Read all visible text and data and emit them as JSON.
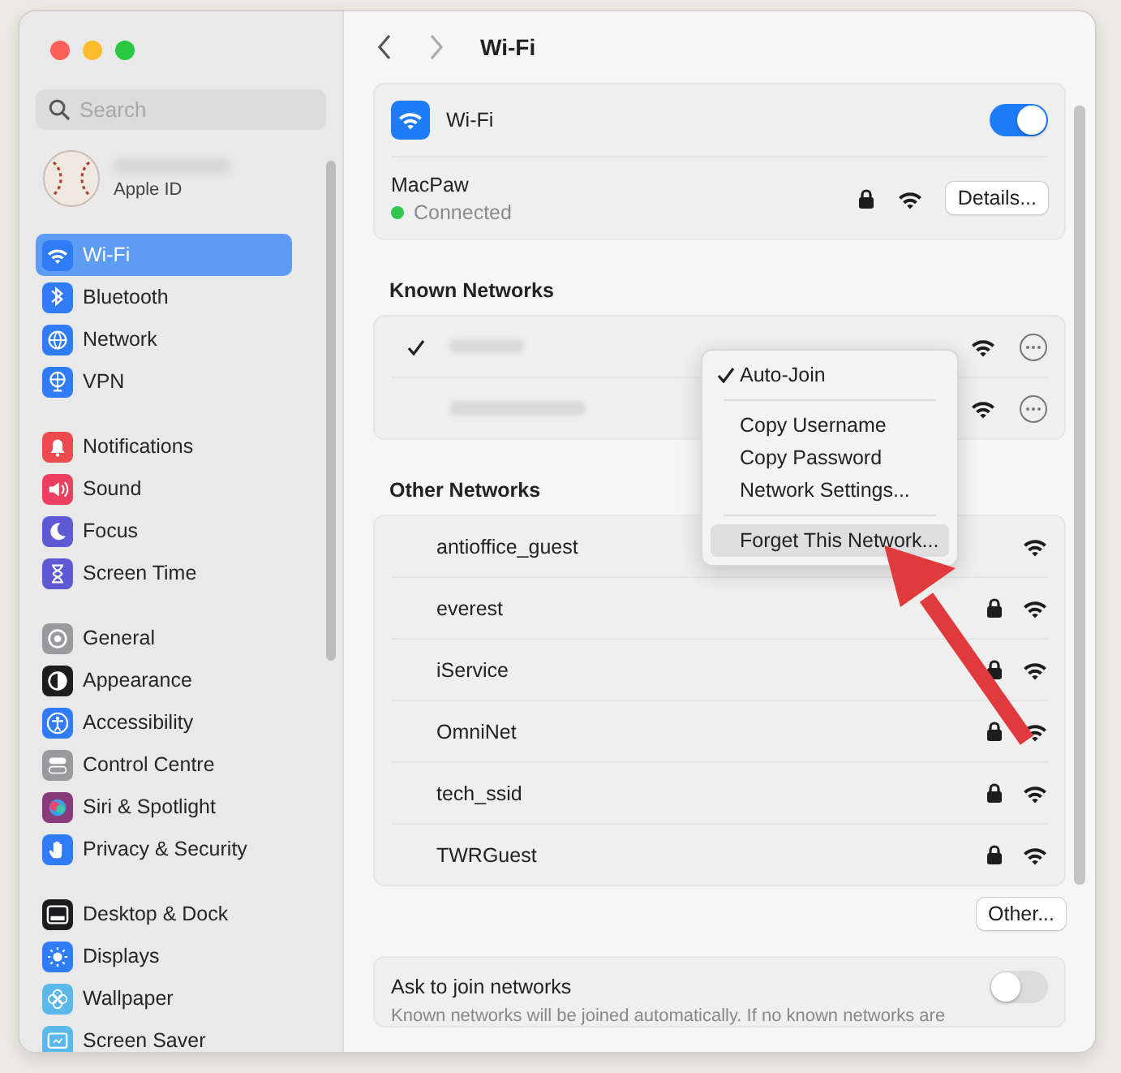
{
  "window": {
    "title": "Wi-Fi"
  },
  "sidebar": {
    "search": {
      "placeholder": "Search"
    },
    "account": {
      "subtitle": "Apple ID"
    },
    "groups": [
      [
        {
          "label": "Wi-Fi",
          "color": "#2f7cf6",
          "selected": true
        },
        {
          "label": "Bluetooth",
          "color": "#2f7cf6",
          "selected": false
        },
        {
          "label": "Network",
          "color": "#2f7cf6",
          "selected": false
        },
        {
          "label": "VPN",
          "color": "#2f7cf6",
          "selected": false
        }
      ],
      [
        {
          "label": "Notifications",
          "color": "#ec4a4f",
          "selected": false
        },
        {
          "label": "Sound",
          "color": "#ec3f5f",
          "selected": false
        },
        {
          "label": "Focus",
          "color": "#5e5ad4",
          "selected": false
        },
        {
          "label": "Screen Time",
          "color": "#5e5ad4",
          "selected": false
        }
      ],
      [
        {
          "label": "General",
          "color": "#9a9a9e",
          "selected": false
        },
        {
          "label": "Appearance",
          "color": "#1d1d1f",
          "selected": false
        },
        {
          "label": "Accessibility",
          "color": "#2f7cf6",
          "selected": false
        },
        {
          "label": "Control Centre",
          "color": "#9a9a9e",
          "selected": false
        },
        {
          "label": "Siri & Spotlight",
          "color": "#8a3b7a",
          "selected": false
        },
        {
          "label": "Privacy & Security",
          "color": "#2f7cf6",
          "selected": false
        }
      ],
      [
        {
          "label": "Desktop & Dock",
          "color": "#1d1d1f",
          "selected": false
        },
        {
          "label": "Displays",
          "color": "#2f7cf6",
          "selected": false
        },
        {
          "label": "Wallpaper",
          "color": "#5ab8ea",
          "selected": false
        },
        {
          "label": "Screen Saver",
          "color": "#5ab8ea",
          "selected": false
        }
      ]
    ]
  },
  "wifi": {
    "label": "Wi-Fi",
    "on": true,
    "current": {
      "name": "MacPaw",
      "status": "Connected",
      "locked": true,
      "button": "Details..."
    }
  },
  "known_networks": {
    "heading": "Known Networks",
    "rows": [
      {
        "checked": true
      },
      {
        "checked": false
      }
    ]
  },
  "menu": {
    "groups": [
      [
        {
          "label": "Auto-Join",
          "checked": true,
          "selected": false
        }
      ],
      [
        {
          "label": "Copy Username",
          "checked": false,
          "selected": false
        },
        {
          "label": "Copy Password",
          "checked": false,
          "selected": false
        },
        {
          "label": "Network Settings...",
          "checked": false,
          "selected": false
        }
      ],
      [
        {
          "label": "Forget This Network...",
          "checked": false,
          "selected": true
        }
      ]
    ]
  },
  "other_networks": {
    "heading": "Other Networks",
    "rows": [
      {
        "name": "antioffice_guest",
        "locked": false
      },
      {
        "name": "everest",
        "locked": true
      },
      {
        "name": "iService",
        "locked": true
      },
      {
        "name": "OmniNet",
        "locked": true
      },
      {
        "name": "tech_ssid",
        "locked": true
      },
      {
        "name": "TWRGuest",
        "locked": true
      }
    ],
    "button": "Other..."
  },
  "ask_to_join": {
    "label": "Ask to join networks",
    "on": false,
    "description": "Known networks will be joined automatically. If no known networks are"
  }
}
